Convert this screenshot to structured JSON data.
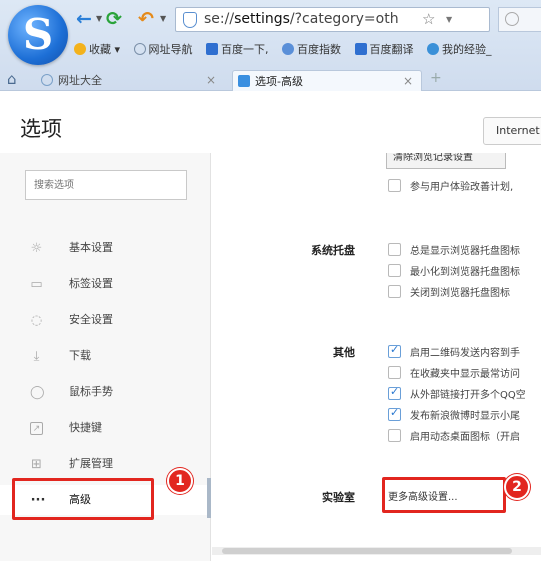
{
  "browser": {
    "logo_letter": "S",
    "icons": {
      "back": "←",
      "refresh": "⟳",
      "undo": "↶",
      "star": "☆",
      "home": "⌂"
    },
    "address": {
      "prefix": "se://",
      "bold": "settings",
      "suffix": "/?category=oth"
    },
    "bookmarks": [
      "收藏",
      "网址导航",
      "百度一下,",
      "百度指数",
      "百度翻译",
      "我的经验_"
    ],
    "bookmark_colors": [
      "#f3b21c",
      "#7a8fa8",
      "#2f6fd0",
      "#2f6fd0",
      "#2f6fd0",
      "#3a90d8"
    ],
    "tabs": [
      {
        "label": "网址大全",
        "close": "×"
      },
      {
        "label": "选项-高级",
        "close": "×"
      }
    ],
    "new_tab": "+"
  },
  "page": {
    "title": "选项",
    "internet_button": "Internet"
  },
  "sidebar": {
    "search_placeholder": "搜索选项",
    "items": [
      {
        "label": "基本设置",
        "icon": "☼"
      },
      {
        "label": "标签设置",
        "icon": "▭"
      },
      {
        "label": "安全设置",
        "icon": "◌"
      },
      {
        "label": "下载",
        "icon": "⤓"
      },
      {
        "label": "鼠标手势",
        "icon": "◯"
      },
      {
        "label": "快捷键",
        "icon": "↗"
      },
      {
        "label": "扩展管理",
        "icon": "⊞"
      },
      {
        "label": "高级",
        "icon": "···"
      }
    ]
  },
  "content": {
    "clear_button": "清除浏览记录设置",
    "top_option": {
      "label": "参与用户体验改善计划,",
      "checked": false
    },
    "sections": [
      {
        "title": "系统托盘",
        "options": [
          {
            "label": "总是显示浏览器托盘图标",
            "checked": false
          },
          {
            "label": "最小化到浏览器托盘图标",
            "checked": false
          },
          {
            "label": "关闭到浏览器托盘图标",
            "checked": false
          }
        ]
      },
      {
        "title": "其他",
        "options": [
          {
            "label": "启用二维码发送内容到手",
            "checked": true
          },
          {
            "label": "在收藏夹中显示最常访问",
            "checked": false
          },
          {
            "label": "从外部链接打开多个QQ空",
            "checked": true
          },
          {
            "label": "发布新浪微博时显示小尾",
            "checked": true
          },
          {
            "label": "启用动态桌面图标（开启",
            "checked": false
          }
        ]
      }
    ],
    "lab": {
      "title": "实验室",
      "link": "更多高级设置..."
    }
  },
  "annotations": {
    "badge_1": "1",
    "badge_2": "2",
    "color": "#e2261f"
  }
}
